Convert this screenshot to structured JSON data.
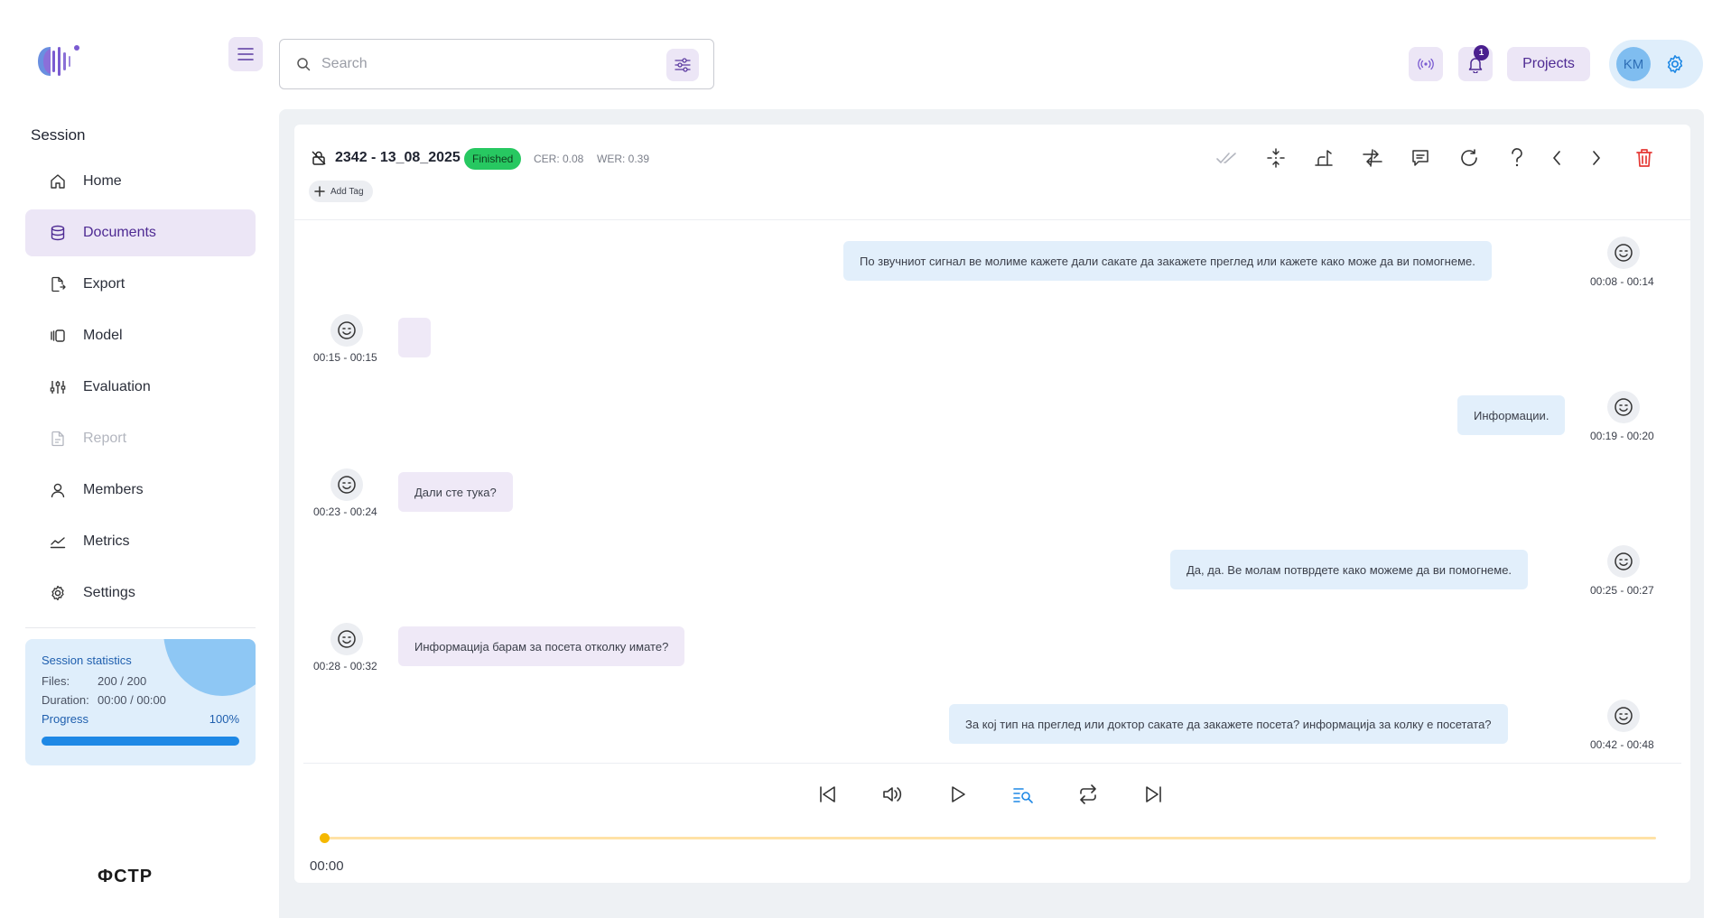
{
  "sidebar": {
    "section_title": "Session",
    "items": [
      {
        "label": "Home",
        "icon": "home-icon"
      },
      {
        "label": "Documents",
        "icon": "database-icon",
        "active": true
      },
      {
        "label": "Export",
        "icon": "file-export-icon"
      },
      {
        "label": "Model",
        "icon": "model-icon"
      },
      {
        "label": "Evaluation",
        "icon": "sliders-icon"
      },
      {
        "label": "Report",
        "icon": "report-icon",
        "disabled": true
      },
      {
        "label": "Members",
        "icon": "user-icon"
      },
      {
        "label": "Metrics",
        "icon": "chart-line-icon"
      },
      {
        "label": "Settings",
        "icon": "gear-icon"
      }
    ],
    "stats": {
      "title": "Session statistics",
      "files_label": "Files:",
      "files_value": "200 / 200",
      "duration_label": "Duration:",
      "duration_value": "00:00 / 00:00",
      "progress_label": "Progress",
      "progress_value": "100%",
      "progress_fraction": 1.0
    },
    "footer_logo": "ФCTP"
  },
  "topbar": {
    "search_placeholder": "Search",
    "projects_label": "Projects",
    "notification_count": "1",
    "user_initials": "KM"
  },
  "document": {
    "title": "2342 - 13_08_2025",
    "status": "Finished",
    "cer": "CER: 0.08",
    "wer": "WER: 0.39",
    "add_tag_label": "Add Tag",
    "tools": [
      "double-check-icon",
      "merge-icon",
      "speaker-icon",
      "swap-icon",
      "comment-icon",
      "refresh-icon",
      "help-icon",
      "chevron-left-icon",
      "chevron-right-icon",
      "trash-icon"
    ]
  },
  "segments": [
    {
      "speaker": "agent",
      "text": "По звучниот сигнал ве молиме кажете дали сакате да закажете преглед или кажете како може да ви помогнеме.",
      "time": "00:08 - 00:14"
    },
    {
      "speaker": "caller",
      "text": "",
      "time": "00:15 - 00:15"
    },
    {
      "speaker": "agent",
      "text": "Информации.",
      "time": "00:19 - 00:20"
    },
    {
      "speaker": "caller",
      "text": "Дали сте тука?",
      "time": "00:23 - 00:24"
    },
    {
      "speaker": "agent",
      "text": "Да, да. Ве молам потврдете како можеме да ви помогнеме.",
      "time": "00:25 - 00:27"
    },
    {
      "speaker": "caller",
      "text": "Информација барам за посета отколку имате?",
      "time": "00:28 - 00:32"
    },
    {
      "speaker": "agent",
      "text": "За кој тип на преглед или доктор сакате да закажете посета? информација за колку е посетата?",
      "time": "00:42 - 00:48"
    }
  ],
  "player": {
    "current_time": "00:00",
    "position_fraction": 0.0,
    "controls": [
      "skip-back-icon",
      "volume-icon",
      "play-icon",
      "search-list-icon",
      "repeat-icon",
      "skip-forward-icon"
    ]
  },
  "colors": {
    "accent_purple": "#4e2a93",
    "status_green": "#27c861",
    "agent_bubble": "#e2effb",
    "caller_bubble": "#efe9f7",
    "delete_red": "#e53935",
    "timeline": "#f5b800"
  }
}
